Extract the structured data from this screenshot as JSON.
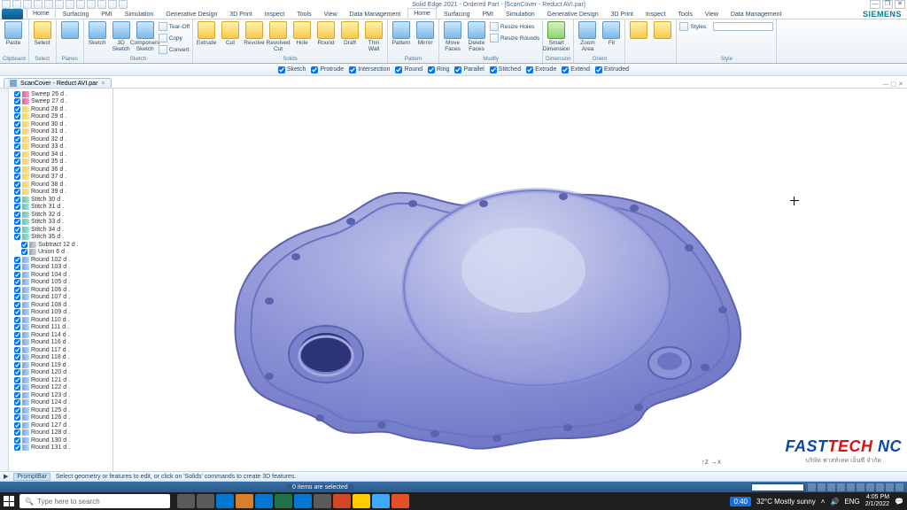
{
  "title": "Solid Edge 2021 - Ordered Part - [ScanCover - Reduct AVI.par]",
  "window_buttons": {
    "min": "—",
    "max": "❐",
    "close": "✕"
  },
  "tabs": [
    {
      "label": "Home",
      "active": true
    },
    {
      "label": "Surfacing"
    },
    {
      "label": "PMI"
    },
    {
      "label": "Simulation"
    },
    {
      "label": "Generative Design"
    },
    {
      "label": "3D Print"
    },
    {
      "label": "Inspect"
    },
    {
      "label": "Tools"
    },
    {
      "label": "View"
    },
    {
      "label": "Data Management"
    }
  ],
  "siemens": "SIEMENS",
  "ribbon_groups": [
    {
      "caption": "Clipboard",
      "bigs": [
        {
          "label": "Paste",
          "ico": "blue"
        }
      ]
    },
    {
      "caption": "Select",
      "bigs": [
        {
          "label": "Select",
          "ico": "yellow"
        }
      ]
    },
    {
      "caption": "Planes",
      "bigs": [
        {
          "label": "",
          "ico": "blue"
        }
      ]
    },
    {
      "caption": "Sketch",
      "bigs": [
        {
          "label": "Sketch",
          "ico": "blue"
        },
        {
          "label": "3D Sketch",
          "ico": "blue"
        },
        {
          "label": "Component Sketch",
          "ico": "blue"
        }
      ],
      "smalls": [
        {
          "label": "Tear-Off"
        },
        {
          "label": "Copy"
        },
        {
          "label": "Convert"
        }
      ]
    },
    {
      "caption": "Solids",
      "bigs": [
        {
          "label": "Extrude",
          "ico": "yellow"
        },
        {
          "label": "Cut",
          "ico": "yellow"
        },
        {
          "label": "Revolve",
          "ico": "yellow"
        },
        {
          "label": "Revolved Cut",
          "ico": "yellow"
        },
        {
          "label": "Hole",
          "ico": "yellow"
        },
        {
          "label": "Round",
          "ico": "yellow"
        },
        {
          "label": "Draft",
          "ico": "yellow"
        },
        {
          "label": "Thin Wall",
          "ico": "yellow"
        }
      ]
    },
    {
      "caption": "Pattern",
      "bigs": [
        {
          "label": "Pattern",
          "ico": "blue"
        },
        {
          "label": "Mirror",
          "ico": "blue"
        }
      ]
    },
    {
      "caption": "Modify",
      "bigs": [
        {
          "label": "Move Faces",
          "ico": "blue"
        },
        {
          "label": "Delete Faces",
          "ico": "blue"
        }
      ],
      "smalls": [
        {
          "label": "Resize Holes"
        },
        {
          "label": "Resize Rounds"
        }
      ]
    },
    {
      "caption": "Dimension",
      "bigs": [
        {
          "label": "Smart Dimension",
          "ico": "green"
        }
      ]
    },
    {
      "caption": "Orient",
      "bigs": [
        {
          "label": "Zoom Area",
          "ico": "blue"
        },
        {
          "label": "Fit",
          "ico": "blue"
        }
      ]
    },
    {
      "caption": "",
      "bigs": [
        {
          "label": "",
          "ico": "yellow"
        },
        {
          "label": "",
          "ico": "yellow"
        }
      ]
    },
    {
      "caption": "Style",
      "bigs": [],
      "styles_label": "Styles:"
    }
  ],
  "filters": [
    "Sketch",
    "Protrude",
    "Intersection",
    "Round",
    "Ring",
    "Parallel",
    "Stitched",
    "Extrude",
    "Extend",
    "Extruded"
  ],
  "doc_tab": {
    "label": "ScanCover - Reduct AVI.par",
    "close": "×"
  },
  "tree": [
    {
      "label": "Sweep 26",
      "kind": "sweep"
    },
    {
      "label": "Sweep 27",
      "kind": "sweep"
    },
    {
      "label": "Round 28",
      "kind": "round"
    },
    {
      "label": "Round 29",
      "kind": "round"
    },
    {
      "label": "Round 30",
      "kind": "round"
    },
    {
      "label": "Round 31",
      "kind": "round"
    },
    {
      "label": "Round 32",
      "kind": "round"
    },
    {
      "label": "Round 33",
      "kind": "round"
    },
    {
      "label": "Round 34",
      "kind": "round"
    },
    {
      "label": "Round 35",
      "kind": "round"
    },
    {
      "label": "Round 36",
      "kind": "round"
    },
    {
      "label": "Round 37",
      "kind": "round"
    },
    {
      "label": "Round 38",
      "kind": "round"
    },
    {
      "label": "Round 39",
      "kind": "round"
    },
    {
      "label": "Stitch 30",
      "kind": "stitch"
    },
    {
      "label": "Stitch 31",
      "kind": "stitch"
    },
    {
      "label": "Stitch 32",
      "kind": "stitch"
    },
    {
      "label": "Stitch 33",
      "kind": "stitch"
    },
    {
      "label": "Stitch 34",
      "kind": "stitch"
    },
    {
      "label": "Stitch 35",
      "kind": "stitch"
    },
    {
      "label": "Subtract 12",
      "kind": "boolsub",
      "indent": true
    },
    {
      "label": "Union 6",
      "kind": "boolsub",
      "indent": true
    },
    {
      "label": "Round 102",
      "kind": "roundblue"
    },
    {
      "label": "Round 103",
      "kind": "roundblue"
    },
    {
      "label": "Round 104",
      "kind": "roundblue"
    },
    {
      "label": "Round 105",
      "kind": "roundblue"
    },
    {
      "label": "Round 106",
      "kind": "roundblue"
    },
    {
      "label": "Round 107",
      "kind": "roundblue"
    },
    {
      "label": "Round 108",
      "kind": "roundblue"
    },
    {
      "label": "Round 109",
      "kind": "roundblue"
    },
    {
      "label": "Round 110",
      "kind": "roundblue"
    },
    {
      "label": "Round 111",
      "kind": "roundblue"
    },
    {
      "label": "Round 114",
      "kind": "roundblue"
    },
    {
      "label": "Round 116",
      "kind": "roundblue"
    },
    {
      "label": "Round 117",
      "kind": "roundblue"
    },
    {
      "label": "Round 118",
      "kind": "roundblue"
    },
    {
      "label": "Round 119",
      "kind": "roundblue"
    },
    {
      "label": "Round 120",
      "kind": "roundblue"
    },
    {
      "label": "Round 121",
      "kind": "roundblue"
    },
    {
      "label": "Round 122",
      "kind": "roundblue"
    },
    {
      "label": "Round 123",
      "kind": "roundblue"
    },
    {
      "label": "Round 124",
      "kind": "roundblue"
    },
    {
      "label": "Round 125",
      "kind": "roundblue"
    },
    {
      "label": "Round 126",
      "kind": "roundblue"
    },
    {
      "label": "Round 127",
      "kind": "roundblue"
    },
    {
      "label": "Round 128",
      "kind": "roundblue"
    },
    {
      "label": "Round 130",
      "kind": "roundblue"
    },
    {
      "label": "Round 131",
      "kind": "roundblue"
    }
  ],
  "fasttech": {
    "brand_fast": "FAST",
    "brand_tech": "TECH",
    "brand_nc": " NC",
    "sub": "บริษัท ฟาสท์เทค เอ็นซี จำกัด"
  },
  "prompt": {
    "label": "PromptBar",
    "text": "Select geometry or features to edit, or click on 'Solids' commands to create 3D features."
  },
  "status": {
    "selection": "0 items are selected"
  },
  "taskbar": {
    "search_placeholder": "Type here to search",
    "weather": "32°C  Mostly sunny",
    "lang": "ENG",
    "time": "4:05 PM",
    "date": "2/1/2022",
    "badge": "0:40",
    "app_colors": [
      "#5a5a5a",
      "#5a5a5a",
      "#0078d4",
      "#d97f28",
      "#0078d4",
      "#217346",
      "#0078d4",
      "#5a5a5a",
      "#d24726",
      "#ffcc00",
      "#40a9ff",
      "#e34f26"
    ]
  }
}
